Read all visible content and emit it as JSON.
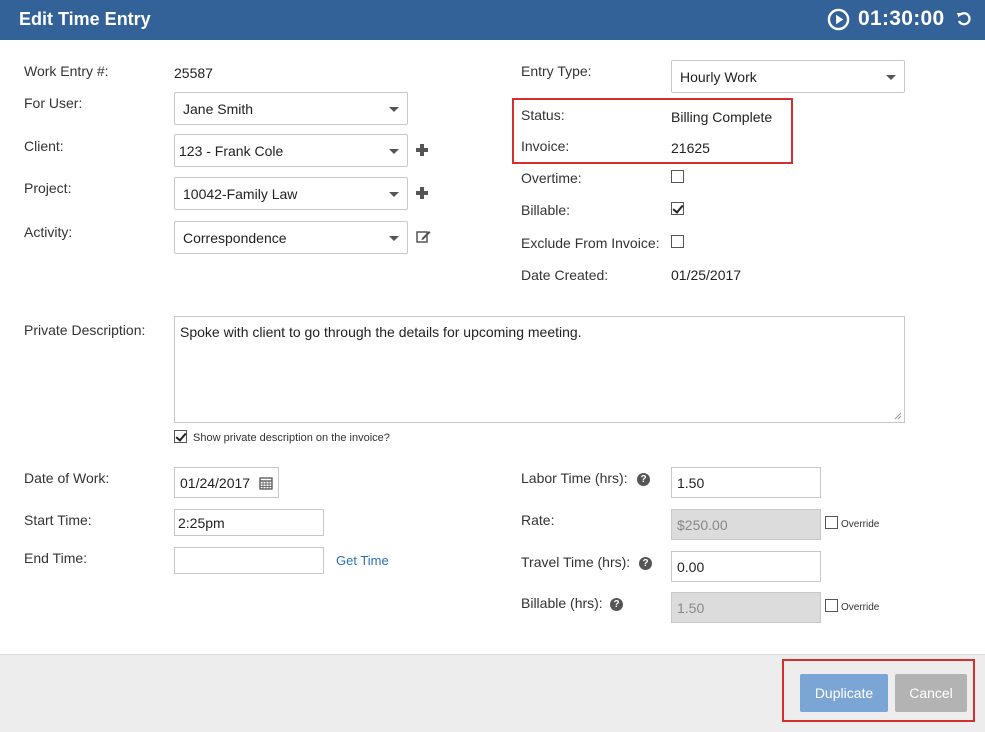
{
  "header": {
    "title": "Edit Time Entry",
    "timer": "01:30:00",
    "play_icon": "play-circle-icon",
    "reset_icon": "reset-icon",
    "color": "#336298"
  },
  "left": {
    "work_entry_label": "Work Entry #:",
    "work_entry_value": "25587",
    "for_user_label": "For User:",
    "for_user_value": "Jane Smith",
    "client_label": "Client:",
    "client_value": "123 - Frank Cole",
    "project_label": "Project:",
    "project_value": "10042-Family Law",
    "activity_label": "Activity:",
    "activity_value": "Correspondence"
  },
  "right": {
    "entry_type_label": "Entry Type:",
    "entry_type_value": "Hourly Work",
    "status_label": "Status:",
    "status_value": "Billing Complete",
    "invoice_label": "Invoice:",
    "invoice_value": "21625",
    "overtime_label": "Overtime:",
    "overtime_checked": false,
    "billable_label": "Billable:",
    "billable_checked": true,
    "exclude_label": "Exclude From Invoice:",
    "exclude_checked": false,
    "date_created_label": "Date Created:",
    "date_created_value": "01/25/2017"
  },
  "description": {
    "label": "Private Description:",
    "value": "Spoke with client to go through the details for upcoming meeting.",
    "show_on_invoice_label": "Show private description on the invoice?",
    "show_on_invoice_checked": true
  },
  "time": {
    "date_label": "Date of Work:",
    "date_value": "01/24/2017",
    "start_label": "Start Time:",
    "start_value": "2:25pm",
    "end_label": "End Time:",
    "end_value": "",
    "get_time_label": "Get Time",
    "labor_label": "Labor Time (hrs):",
    "labor_value": "1.50",
    "rate_label": "Rate:",
    "rate_value": "$250.00",
    "travel_label": "Travel Time (hrs):",
    "travel_value": "0.00",
    "billable_hrs_label": "Billable (hrs):",
    "billable_hrs_value": "1.50",
    "override_label": "Override"
  },
  "footer": {
    "duplicate_label": "Duplicate",
    "cancel_label": "Cancel",
    "highlight_color": "#d32f2f"
  }
}
